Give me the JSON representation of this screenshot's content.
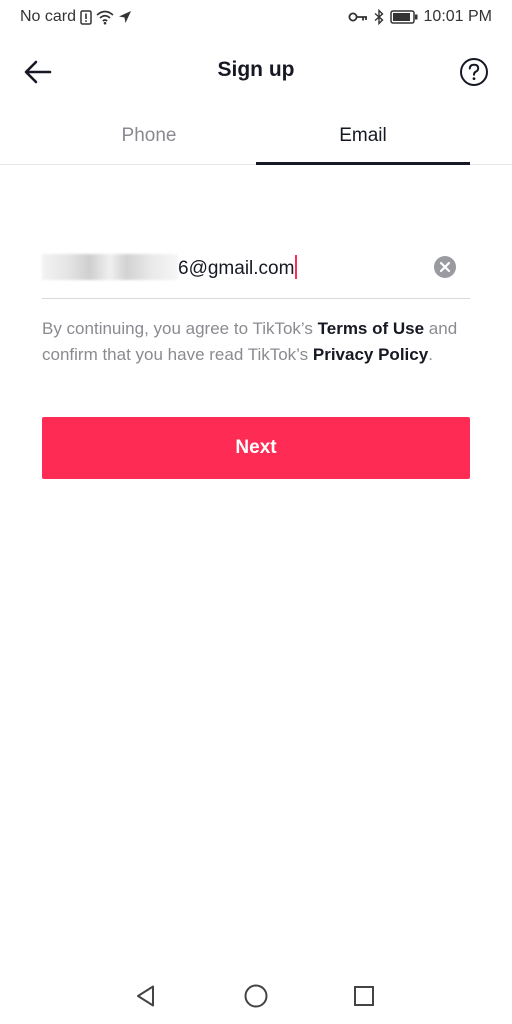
{
  "status_bar": {
    "carrier": "No card",
    "time": "10:01 PM"
  },
  "header": {
    "title": "Sign up"
  },
  "tabs": [
    {
      "label": "Phone",
      "selected": false
    },
    {
      "label": "Email",
      "selected": true
    }
  ],
  "email_field": {
    "value_visible_suffix": "6@gmail.com"
  },
  "terms": {
    "prefix": "By continuing, you agree to TikTok’s ",
    "terms_link": "Terms of Use",
    "middle": " and confirm that you have read TikTok’s ",
    "privacy_link": "Privacy Policy",
    "suffix": "."
  },
  "next_button": {
    "label": "Next"
  },
  "colors": {
    "accent": "#fe2c55",
    "text_primary": "#161823",
    "text_secondary": "#8a8b91"
  },
  "icons": {
    "back": "arrow-left-icon",
    "help": "question-circle-icon",
    "clear": "clear-circle-icon",
    "nav_back": "triangle-back-icon",
    "nav_home": "circle-home-icon",
    "nav_recent": "square-recent-icon"
  }
}
